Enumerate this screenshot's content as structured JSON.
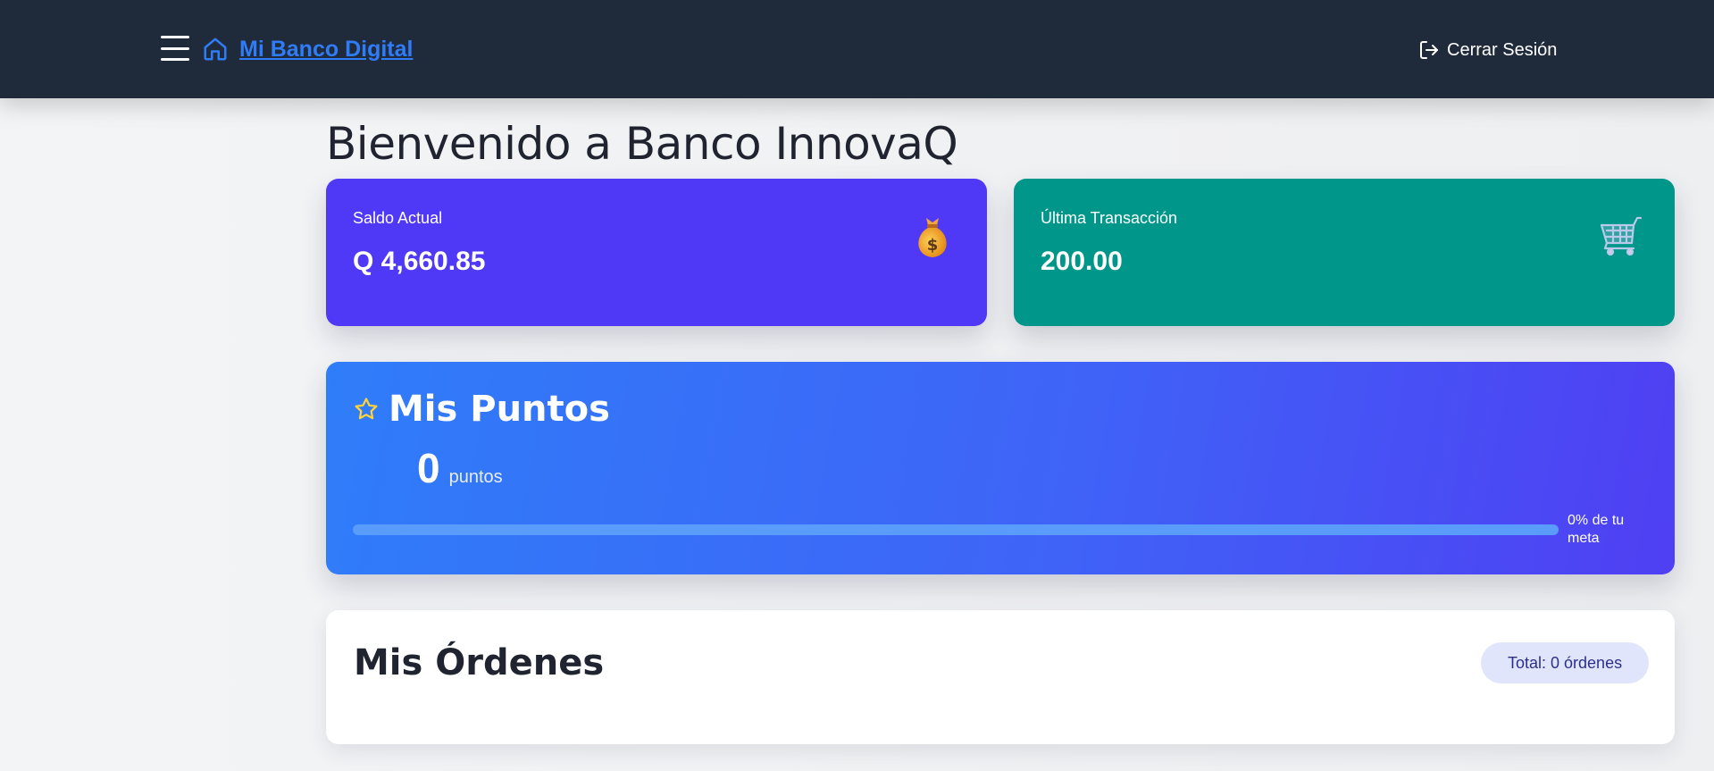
{
  "navbar": {
    "brand_label": "Mi Banco Digital",
    "logout_label": "Cerrar Sesión",
    "menu_icon": "hamburger-menu-icon",
    "home_icon": "home-icon",
    "logout_icon": "logout-icon"
  },
  "main": {
    "title": "Bienvenido a Banco InnovaQ"
  },
  "balance_card": {
    "label": "Saldo Actual",
    "value": "Q 4,660.85",
    "icon": "money-bag-icon",
    "color": "#4f38f6"
  },
  "last_transaction_card": {
    "label": "Última Transacción",
    "value": "200.00",
    "icon": "shopping-cart-icon",
    "color": "#009689"
  },
  "points_card": {
    "title": "Mis Puntos",
    "value": "0",
    "unit": "puntos",
    "progress_percent": 0,
    "progress_label": "0% de tu meta",
    "icon": "star-icon"
  },
  "orders_card": {
    "title": "Mis Órdenes",
    "badge": "Total: 0 órdenes"
  },
  "colors": {
    "navbar": "#1f2a3a",
    "brand": "#2f7cf6"
  }
}
